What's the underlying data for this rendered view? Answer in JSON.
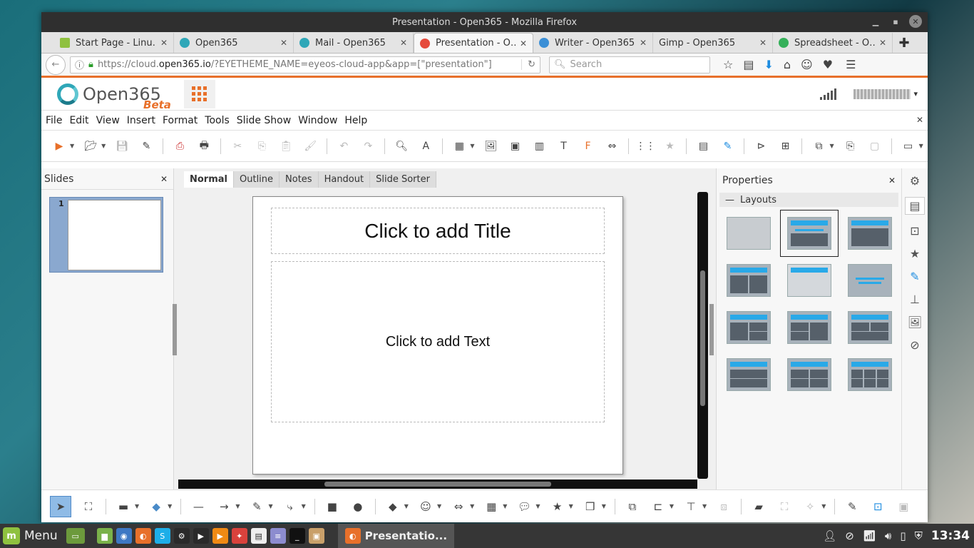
{
  "window": {
    "title": "Presentation - Open365 - Mozilla Firefox"
  },
  "tabs": [
    {
      "label": "Start Page - Linu…",
      "color": "#8fc13f"
    },
    {
      "label": "Open365",
      "color": "#2fa7b8"
    },
    {
      "label": "Mail - Open365",
      "color": "#2fa7b8"
    },
    {
      "label": "Presentation - O…",
      "color": "#e54b3c"
    },
    {
      "label": "Writer - Open365",
      "color": "#3b8fd6"
    },
    {
      "label": "Gimp - Open365",
      "color": "#ffffff"
    },
    {
      "label": "Spreadsheet - O…",
      "color": "#35b05a"
    }
  ],
  "nav": {
    "url_prefix": "https://cloud.",
    "url_host": "open365.io",
    "url_rest": "/?EYETHEME_NAME=eyeos-cloud-app&app=[\"presentation\"]",
    "search_placeholder": "Search"
  },
  "app": {
    "logo_text": "Open365",
    "logo_badge": "Beta"
  },
  "menu": [
    "File",
    "Edit",
    "View",
    "Insert",
    "Format",
    "Tools",
    "Slide Show",
    "Window",
    "Help"
  ],
  "slides_panel": {
    "title": "Slides",
    "slide_number": "1"
  },
  "view_tabs": [
    "Normal",
    "Outline",
    "Notes",
    "Handout",
    "Slide Sorter"
  ],
  "slide": {
    "title_placeholder": "Click to add Title",
    "text_placeholder": "Click to add Text"
  },
  "properties": {
    "title": "Properties",
    "section": "Layouts"
  },
  "taskbar": {
    "menu_label": "Menu",
    "active_app": "Presentatio...",
    "clock": "13:34"
  },
  "colors": {
    "accent": "#e8702a",
    "layout_header": "#29a9e8"
  }
}
